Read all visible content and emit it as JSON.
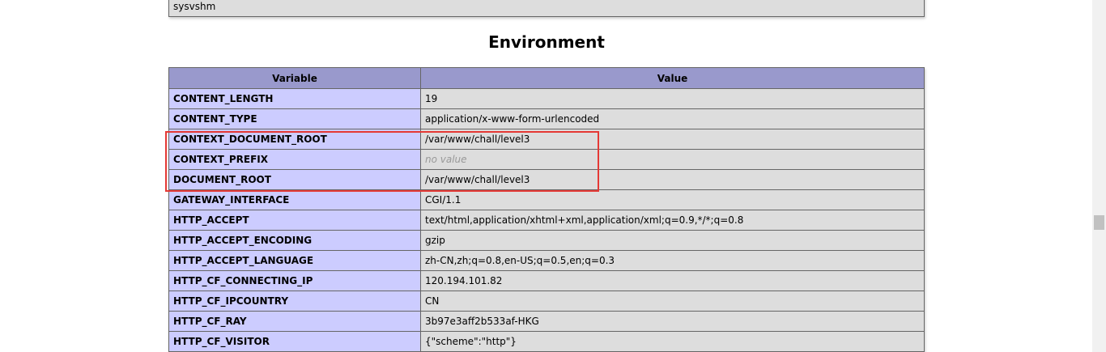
{
  "prev_section": {
    "last_value": "sysvshm"
  },
  "section": {
    "title": "Environment"
  },
  "table": {
    "headers": [
      "Variable",
      "Value"
    ],
    "rows": [
      {
        "name": "CONTENT_LENGTH",
        "value": "19"
      },
      {
        "name": "CONTENT_TYPE",
        "value": "application/x-www-form-urlencoded"
      },
      {
        "name": "CONTEXT_DOCUMENT_ROOT",
        "value": "/var/www/chall/level3"
      },
      {
        "name": "CONTEXT_PREFIX",
        "value": "no value"
      },
      {
        "name": "DOCUMENT_ROOT",
        "value": "/var/www/chall/level3"
      },
      {
        "name": "GATEWAY_INTERFACE",
        "value": "CGI/1.1"
      },
      {
        "name": "HTTP_ACCEPT",
        "value": "text/html,application/xhtml+xml,application/xml;q=0.9,*/*;q=0.8"
      },
      {
        "name": "HTTP_ACCEPT_ENCODING",
        "value": "gzip"
      },
      {
        "name": "HTTP_ACCEPT_LANGUAGE",
        "value": "zh-CN,zh;q=0.8,en-US;q=0.5,en;q=0.3"
      },
      {
        "name": "HTTP_CF_CONNECTING_IP",
        "value": "120.194.101.82"
      },
      {
        "name": "HTTP_CF_IPCOUNTRY",
        "value": "CN"
      },
      {
        "name": "HTTP_CF_RAY",
        "value": "3b97e3aff2b533af-HKG"
      },
      {
        "name": "HTTP_CF_VISITOR",
        "value": "{\"scheme\":\"http\"}"
      }
    ]
  },
  "colors": {
    "header_bg": "#9999cc",
    "name_cell_bg": "#ccccff",
    "value_cell_bg": "#dddddd",
    "highlight_border": "#e53935"
  }
}
